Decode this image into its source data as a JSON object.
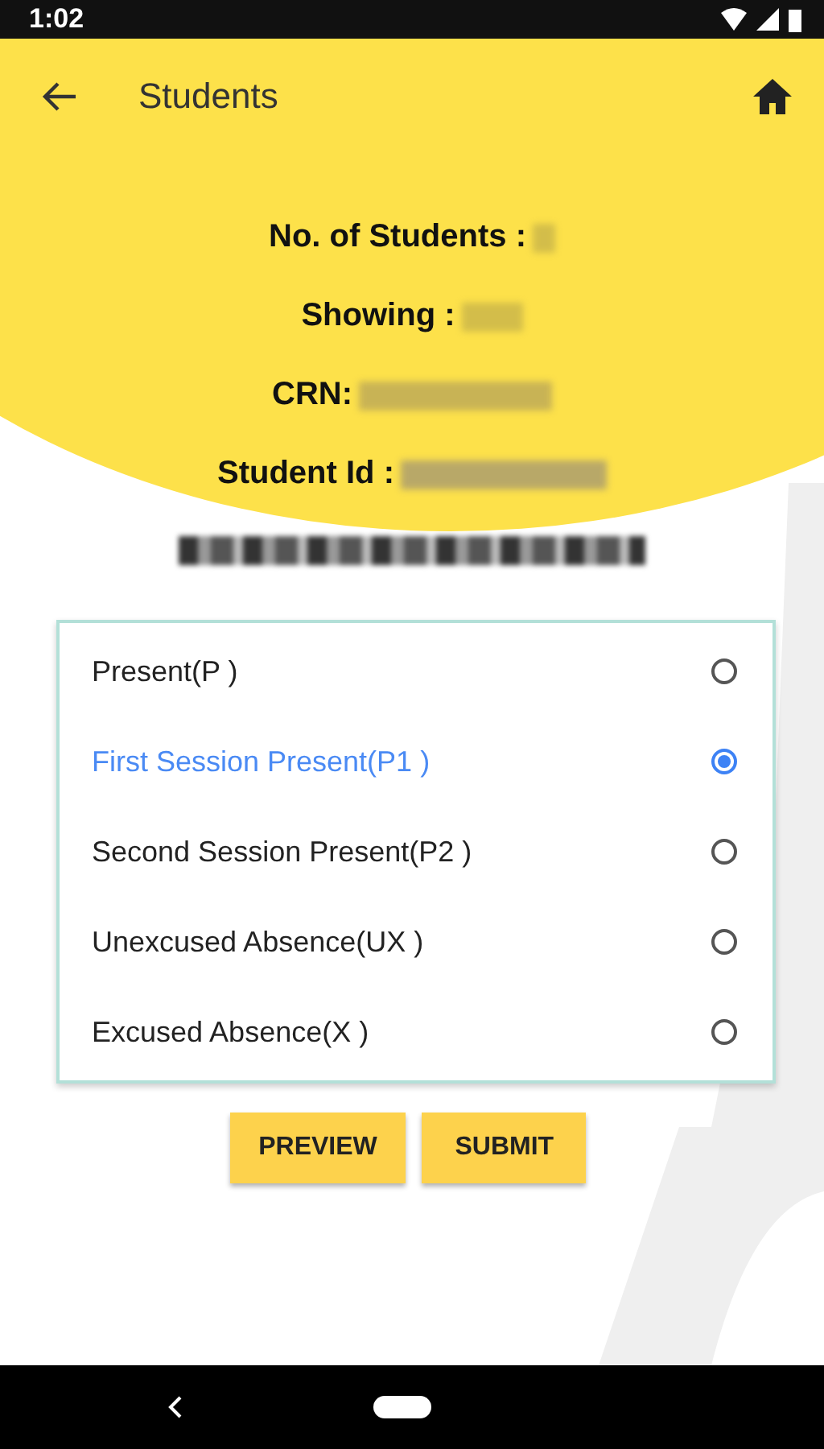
{
  "status_bar": {
    "time": "1:02"
  },
  "app_bar": {
    "title": "Students"
  },
  "info": [
    {
      "label": "No. of Students :"
    },
    {
      "label": "Showing :"
    },
    {
      "label": "CRN:"
    },
    {
      "label": "Student Id :"
    }
  ],
  "attendance_options": [
    {
      "label": "Present(P )",
      "selected": false
    },
    {
      "label": "First Session Present(P1 )",
      "selected": true
    },
    {
      "label": "Second Session Present(P2 )",
      "selected": false
    },
    {
      "label": "Unexcused Absence(UX )",
      "selected": false
    },
    {
      "label": "Excused Absence(X )",
      "selected": false
    }
  ],
  "buttons": [
    "PREVIEW",
    "SUBMIT"
  ]
}
